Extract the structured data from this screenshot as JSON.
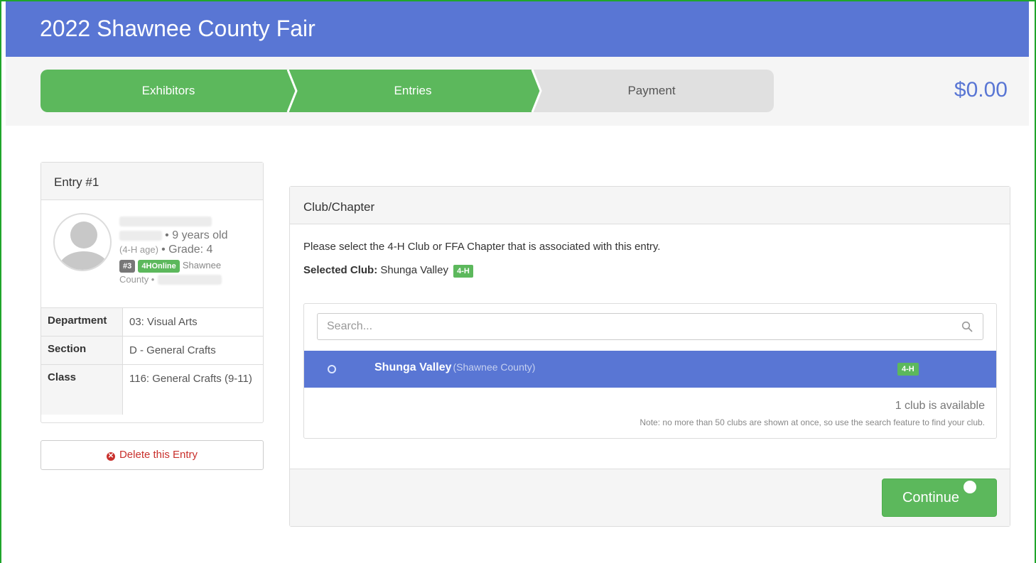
{
  "header": {
    "title": "2022 Shawnee County Fair"
  },
  "steps": [
    {
      "label": "Exhibitors",
      "state": "complete"
    },
    {
      "label": "Entries",
      "state": "active"
    },
    {
      "label": "Payment",
      "state": "pending"
    }
  ],
  "total": "$0.00",
  "entry": {
    "title": "Entry #1",
    "age_text": "• 9 years old",
    "age_note": "(4-H age)",
    "grade_text": "• Grade: 4",
    "badge_number": "#3",
    "badge_source": "4HOnline",
    "county": "Shawnee",
    "county_suffix": "County •",
    "details": [
      {
        "key": "Department",
        "value": "03: Visual Arts"
      },
      {
        "key": "Section",
        "value": "D - General Crafts"
      },
      {
        "key": "Class",
        "value": "116: General Crafts (9-11)"
      }
    ],
    "delete_label": "Delete this Entry"
  },
  "club": {
    "panel_title": "Club/Chapter",
    "instruction": "Please select the 4-H Club or FFA Chapter that is associated with this entry.",
    "selected_label": "Selected Club:",
    "selected_value": "Shunga Valley",
    "selected_tag": "4-H",
    "search_placeholder": "Search...",
    "rows": [
      {
        "name": "Shunga Valley",
        "county": "(Shawnee County)",
        "tag": "4-H",
        "selected": true
      }
    ],
    "available_text": "1 club is available",
    "note_text": "Note: no more than 50 clubs are shown at once, so use the search feature to find your club.",
    "continue_label": "Continue"
  },
  "colors": {
    "primary": "#5976d4",
    "success": "#5cb85c",
    "danger": "#c9302c",
    "frame": "#1fa52a"
  },
  "icons": [
    "search-icon",
    "times-circle-icon",
    "arrow-circle-right-icon",
    "avatar-icon"
  ]
}
